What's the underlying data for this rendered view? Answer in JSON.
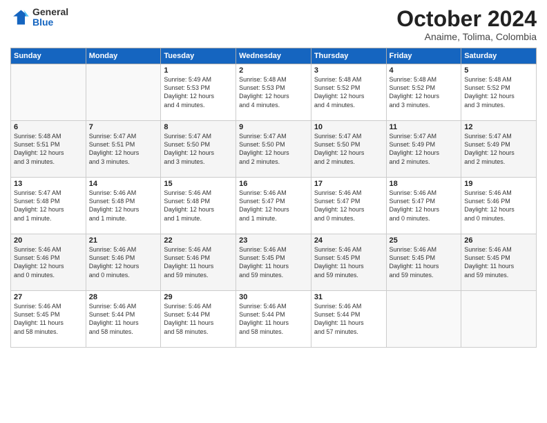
{
  "logo": {
    "general": "General",
    "blue": "Blue"
  },
  "title": "October 2024",
  "subtitle": "Anaime, Tolima, Colombia",
  "days": [
    "Sunday",
    "Monday",
    "Tuesday",
    "Wednesday",
    "Thursday",
    "Friday",
    "Saturday"
  ],
  "weeks": [
    [
      {
        "day": "",
        "content": ""
      },
      {
        "day": "",
        "content": ""
      },
      {
        "day": "1",
        "content": "Sunrise: 5:49 AM\nSunset: 5:53 PM\nDaylight: 12 hours\nand 4 minutes."
      },
      {
        "day": "2",
        "content": "Sunrise: 5:48 AM\nSunset: 5:53 PM\nDaylight: 12 hours\nand 4 minutes."
      },
      {
        "day": "3",
        "content": "Sunrise: 5:48 AM\nSunset: 5:52 PM\nDaylight: 12 hours\nand 4 minutes."
      },
      {
        "day": "4",
        "content": "Sunrise: 5:48 AM\nSunset: 5:52 PM\nDaylight: 12 hours\nand 3 minutes."
      },
      {
        "day": "5",
        "content": "Sunrise: 5:48 AM\nSunset: 5:52 PM\nDaylight: 12 hours\nand 3 minutes."
      }
    ],
    [
      {
        "day": "6",
        "content": "Sunrise: 5:48 AM\nSunset: 5:51 PM\nDaylight: 12 hours\nand 3 minutes."
      },
      {
        "day": "7",
        "content": "Sunrise: 5:47 AM\nSunset: 5:51 PM\nDaylight: 12 hours\nand 3 minutes."
      },
      {
        "day": "8",
        "content": "Sunrise: 5:47 AM\nSunset: 5:50 PM\nDaylight: 12 hours\nand 3 minutes."
      },
      {
        "day": "9",
        "content": "Sunrise: 5:47 AM\nSunset: 5:50 PM\nDaylight: 12 hours\nand 2 minutes."
      },
      {
        "day": "10",
        "content": "Sunrise: 5:47 AM\nSunset: 5:50 PM\nDaylight: 12 hours\nand 2 minutes."
      },
      {
        "day": "11",
        "content": "Sunrise: 5:47 AM\nSunset: 5:49 PM\nDaylight: 12 hours\nand 2 minutes."
      },
      {
        "day": "12",
        "content": "Sunrise: 5:47 AM\nSunset: 5:49 PM\nDaylight: 12 hours\nand 2 minutes."
      }
    ],
    [
      {
        "day": "13",
        "content": "Sunrise: 5:47 AM\nSunset: 5:48 PM\nDaylight: 12 hours\nand 1 minute."
      },
      {
        "day": "14",
        "content": "Sunrise: 5:46 AM\nSunset: 5:48 PM\nDaylight: 12 hours\nand 1 minute."
      },
      {
        "day": "15",
        "content": "Sunrise: 5:46 AM\nSunset: 5:48 PM\nDaylight: 12 hours\nand 1 minute."
      },
      {
        "day": "16",
        "content": "Sunrise: 5:46 AM\nSunset: 5:47 PM\nDaylight: 12 hours\nand 1 minute."
      },
      {
        "day": "17",
        "content": "Sunrise: 5:46 AM\nSunset: 5:47 PM\nDaylight: 12 hours\nand 0 minutes."
      },
      {
        "day": "18",
        "content": "Sunrise: 5:46 AM\nSunset: 5:47 PM\nDaylight: 12 hours\nand 0 minutes."
      },
      {
        "day": "19",
        "content": "Sunrise: 5:46 AM\nSunset: 5:46 PM\nDaylight: 12 hours\nand 0 minutes."
      }
    ],
    [
      {
        "day": "20",
        "content": "Sunrise: 5:46 AM\nSunset: 5:46 PM\nDaylight: 12 hours\nand 0 minutes."
      },
      {
        "day": "21",
        "content": "Sunrise: 5:46 AM\nSunset: 5:46 PM\nDaylight: 12 hours\nand 0 minutes."
      },
      {
        "day": "22",
        "content": "Sunrise: 5:46 AM\nSunset: 5:46 PM\nDaylight: 11 hours\nand 59 minutes."
      },
      {
        "day": "23",
        "content": "Sunrise: 5:46 AM\nSunset: 5:45 PM\nDaylight: 11 hours\nand 59 minutes."
      },
      {
        "day": "24",
        "content": "Sunrise: 5:46 AM\nSunset: 5:45 PM\nDaylight: 11 hours\nand 59 minutes."
      },
      {
        "day": "25",
        "content": "Sunrise: 5:46 AM\nSunset: 5:45 PM\nDaylight: 11 hours\nand 59 minutes."
      },
      {
        "day": "26",
        "content": "Sunrise: 5:46 AM\nSunset: 5:45 PM\nDaylight: 11 hours\nand 59 minutes."
      }
    ],
    [
      {
        "day": "27",
        "content": "Sunrise: 5:46 AM\nSunset: 5:45 PM\nDaylight: 11 hours\nand 58 minutes."
      },
      {
        "day": "28",
        "content": "Sunrise: 5:46 AM\nSunset: 5:44 PM\nDaylight: 11 hours\nand 58 minutes."
      },
      {
        "day": "29",
        "content": "Sunrise: 5:46 AM\nSunset: 5:44 PM\nDaylight: 11 hours\nand 58 minutes."
      },
      {
        "day": "30",
        "content": "Sunrise: 5:46 AM\nSunset: 5:44 PM\nDaylight: 11 hours\nand 58 minutes."
      },
      {
        "day": "31",
        "content": "Sunrise: 5:46 AM\nSunset: 5:44 PM\nDaylight: 11 hours\nand 57 minutes."
      },
      {
        "day": "",
        "content": ""
      },
      {
        "day": "",
        "content": ""
      }
    ]
  ]
}
